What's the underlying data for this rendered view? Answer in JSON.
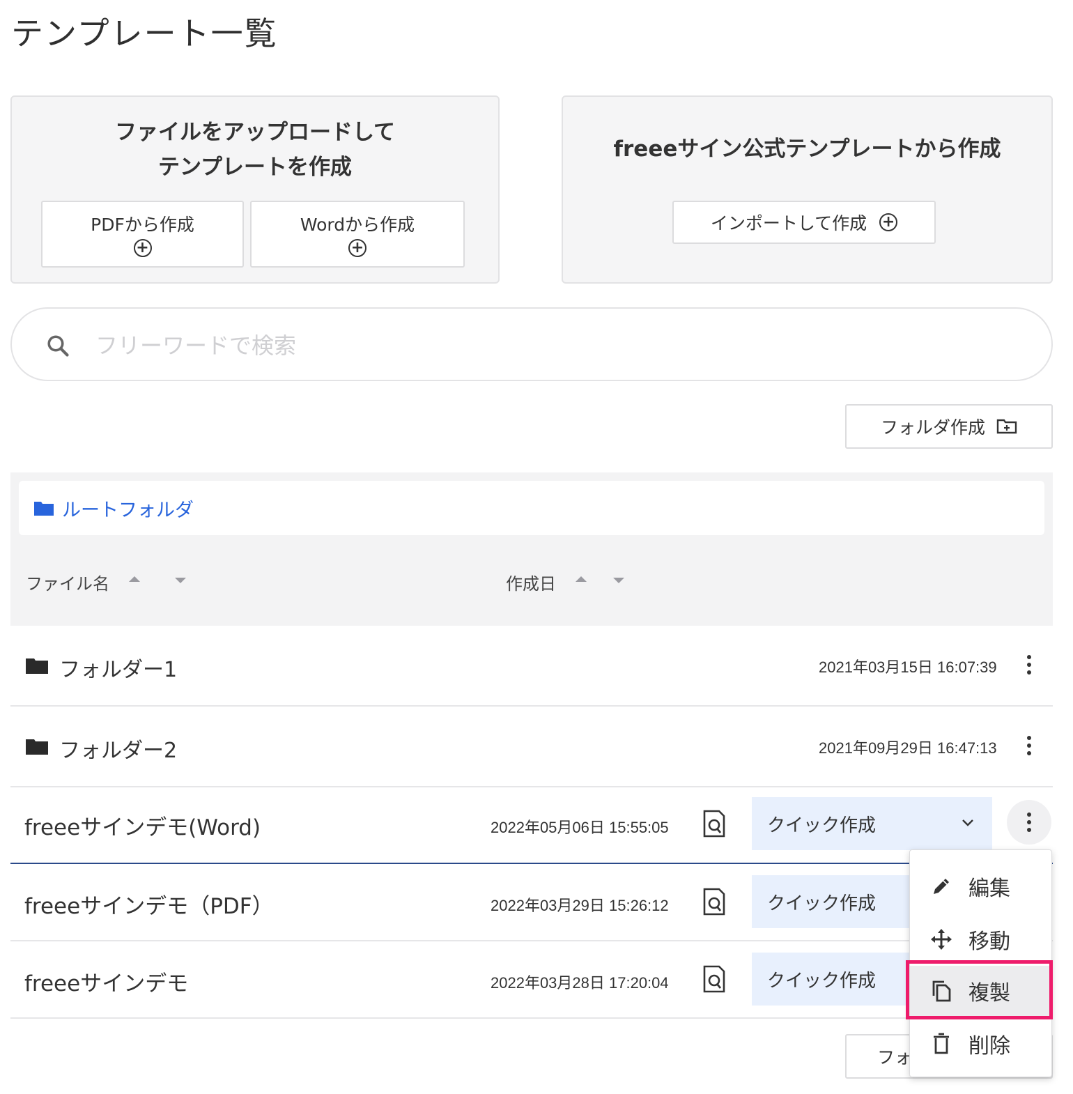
{
  "page": {
    "title": "テンプレート一覧"
  },
  "upload_card": {
    "title_line1": "ファイルをアップロードして",
    "title_line2": "テンプレートを作成",
    "pdf_button": "PDFから作成",
    "word_button": "Wordから作成"
  },
  "official_card": {
    "title": "freeeサイン公式テンプレートから作成",
    "import_button": "インポートして作成"
  },
  "search": {
    "placeholder": "フリーワードで検索",
    "value": ""
  },
  "folder_create_button": "フォルダ作成",
  "folder_create_button_bottom": "フォ",
  "breadcrumb": {
    "root_label": "ルートフォルダ"
  },
  "columns": {
    "name": "ファイル名",
    "created": "作成日"
  },
  "folders": [
    {
      "name": "フォルダー1",
      "created": "2021年03月15日 16:07:39"
    },
    {
      "name": "フォルダー2",
      "created": "2021年09月29日 16:47:13"
    }
  ],
  "templates": [
    {
      "name": "freeeサインデモ(Word)",
      "created": "2022年05月06日 15:55:05",
      "action": "クイック作成"
    },
    {
      "name": "freeeサインデモ（PDF）",
      "created": "2022年03月29日 15:26:12",
      "action": "クイック作成"
    },
    {
      "name": "freeeサインデモ",
      "created": "2022年03月28日 17:20:04",
      "action": "クイック作成"
    }
  ],
  "context_menu": {
    "items": [
      {
        "label": "編集",
        "icon": "pencil-icon"
      },
      {
        "label": "移動",
        "icon": "move-icon"
      },
      {
        "label": "複製",
        "icon": "copy-icon"
      },
      {
        "label": "削除",
        "icon": "trash-icon"
      }
    ],
    "highlighted": "複製"
  },
  "colors": {
    "accent": "#2864dc",
    "highlight": "#ee1c6b",
    "quick_bg": "#e8f0fd",
    "panel_bg": "#f3f3f4"
  }
}
